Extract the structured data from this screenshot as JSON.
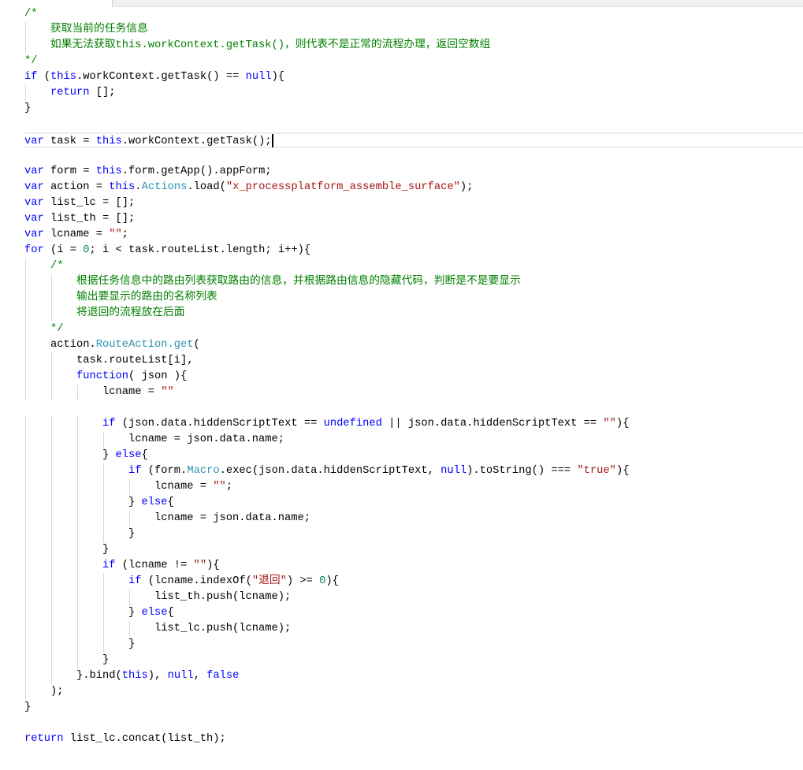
{
  "editor": {
    "current_line": 9,
    "lines": [
      [
        [
          "c",
          "/*"
        ]
      ],
      [
        [
          "c",
          "    获取当前的任务信息"
        ]
      ],
      [
        [
          "c",
          "    如果无法获取this.workContext.getTask()，则代表不是正常的流程办理，返回空数组"
        ]
      ],
      [
        [
          "c",
          "*/"
        ]
      ],
      [
        [
          "k",
          "if"
        ],
        [
          "p",
          " ("
        ],
        [
          "k",
          "this"
        ],
        [
          "p",
          ".workContext.getTask() == "
        ],
        [
          "k",
          "null"
        ],
        [
          "p",
          "){"
        ]
      ],
      [
        [
          "p",
          "    "
        ],
        [
          "k",
          "return"
        ],
        [
          "p",
          " [];"
        ]
      ],
      [
        [
          "p",
          "}"
        ]
      ],
      [],
      [
        [
          "k",
          "var"
        ],
        [
          "p",
          " task = "
        ],
        [
          "k",
          "this"
        ],
        [
          "p",
          ".workContext.getTask();"
        ]
      ],
      [],
      [
        [
          "k",
          "var"
        ],
        [
          "p",
          " form = "
        ],
        [
          "k",
          "this"
        ],
        [
          "p",
          ".form.getApp().appForm;"
        ]
      ],
      [
        [
          "k",
          "var"
        ],
        [
          "p",
          " action = "
        ],
        [
          "k",
          "this"
        ],
        [
          "p",
          "."
        ],
        [
          "t",
          "Actions"
        ],
        [
          "p",
          ".load("
        ],
        [
          "s",
          "\"x_processplatform_assemble_surface\""
        ],
        [
          "p",
          ");"
        ]
      ],
      [
        [
          "k",
          "var"
        ],
        [
          "p",
          " list_lc = [];"
        ]
      ],
      [
        [
          "k",
          "var"
        ],
        [
          "p",
          " list_th = [];"
        ]
      ],
      [
        [
          "k",
          "var"
        ],
        [
          "p",
          " lcname = "
        ],
        [
          "s",
          "\"\""
        ],
        [
          "p",
          ";"
        ]
      ],
      [
        [
          "k",
          "for"
        ],
        [
          "p",
          " (i = "
        ],
        [
          "n",
          "0"
        ],
        [
          "p",
          "; i < task.routeList.length; i++){"
        ]
      ],
      [
        [
          "c",
          "    /*"
        ]
      ],
      [
        [
          "c",
          "        根据任务信息中的路由列表获取路由的信息，并根据路由信息的隐藏代码，判断是不是要显示"
        ]
      ],
      [
        [
          "c",
          "        输出要显示的路由的名称列表"
        ]
      ],
      [
        [
          "c",
          "        将退回的流程放在后面"
        ]
      ],
      [
        [
          "c",
          "    */"
        ]
      ],
      [
        [
          "p",
          "    action."
        ],
        [
          "t",
          "RouteAction.get"
        ],
        [
          "p",
          "("
        ]
      ],
      [
        [
          "p",
          "        task.routeList[i],"
        ]
      ],
      [
        [
          "p",
          "        "
        ],
        [
          "k",
          "function"
        ],
        [
          "p",
          "( json ){"
        ]
      ],
      [
        [
          "p",
          "            lcname = "
        ],
        [
          "s",
          "\"\""
        ]
      ],
      [],
      [
        [
          "p",
          "            "
        ],
        [
          "k",
          "if"
        ],
        [
          "p",
          " (json.data.hiddenScriptText == "
        ],
        [
          "k",
          "undefined"
        ],
        [
          "p",
          " || json.data.hiddenScriptText == "
        ],
        [
          "s",
          "\"\""
        ],
        [
          "p",
          "){"
        ]
      ],
      [
        [
          "p",
          "                lcname = json.data.name;"
        ]
      ],
      [
        [
          "p",
          "            } "
        ],
        [
          "k",
          "else"
        ],
        [
          "p",
          "{"
        ]
      ],
      [
        [
          "p",
          "                "
        ],
        [
          "k",
          "if"
        ],
        [
          "p",
          " (form."
        ],
        [
          "t",
          "Macro"
        ],
        [
          "p",
          ".exec(json.data.hiddenScriptText, "
        ],
        [
          "k",
          "null"
        ],
        [
          "p",
          ").toString() === "
        ],
        [
          "s",
          "\"true\""
        ],
        [
          "p",
          "){"
        ]
      ],
      [
        [
          "p",
          "                    lcname = "
        ],
        [
          "s",
          "\"\""
        ],
        [
          "p",
          ";"
        ]
      ],
      [
        [
          "p",
          "                } "
        ],
        [
          "k",
          "else"
        ],
        [
          "p",
          "{"
        ]
      ],
      [
        [
          "p",
          "                    lcname = json.data.name;"
        ]
      ],
      [
        [
          "p",
          "                }"
        ]
      ],
      [
        [
          "p",
          "            }"
        ]
      ],
      [
        [
          "p",
          "            "
        ],
        [
          "k",
          "if"
        ],
        [
          "p",
          " (lcname != "
        ],
        [
          "s",
          "\"\""
        ],
        [
          "p",
          "){"
        ]
      ],
      [
        [
          "p",
          "                "
        ],
        [
          "k",
          "if"
        ],
        [
          "p",
          " (lcname.indexOf("
        ],
        [
          "s",
          "\"退回\""
        ],
        [
          "p",
          ") >= "
        ],
        [
          "n",
          "0"
        ],
        [
          "p",
          "){"
        ]
      ],
      [
        [
          "p",
          "                    list_th.push(lcname);"
        ]
      ],
      [
        [
          "p",
          "                } "
        ],
        [
          "k",
          "else"
        ],
        [
          "p",
          "{"
        ]
      ],
      [
        [
          "p",
          "                    list_lc.push(lcname);"
        ]
      ],
      [
        [
          "p",
          "                }"
        ]
      ],
      [
        [
          "p",
          "            }"
        ]
      ],
      [
        [
          "p",
          "        }.bind("
        ],
        [
          "k",
          "this"
        ],
        [
          "p",
          "), "
        ],
        [
          "k",
          "null"
        ],
        [
          "p",
          ", "
        ],
        [
          "k",
          "false"
        ]
      ],
      [
        [
          "p",
          "    );"
        ]
      ],
      [
        [
          "p",
          "}"
        ]
      ],
      [],
      [
        [
          "k",
          "return"
        ],
        [
          "p",
          " list_lc.concat(list_th);"
        ]
      ]
    ]
  }
}
